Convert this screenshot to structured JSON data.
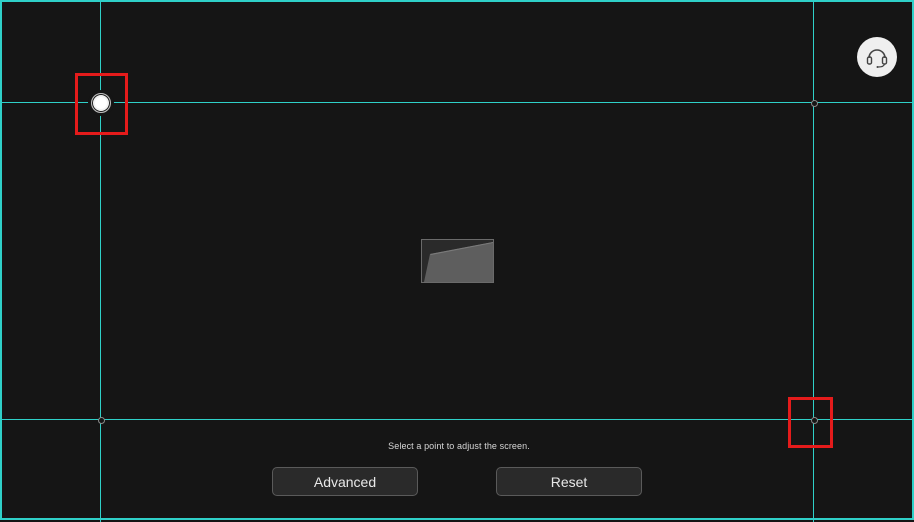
{
  "instruction": "Select a point to adjust the screen.",
  "buttons": {
    "advanced": "Advanced",
    "reset": "Reset"
  },
  "icons": {
    "help": "headset-icon",
    "preview": "keystone-preview-icon"
  },
  "colors": {
    "guide_line": "#2fd0c8",
    "highlight": "#e41b1b",
    "background": "#151515"
  }
}
